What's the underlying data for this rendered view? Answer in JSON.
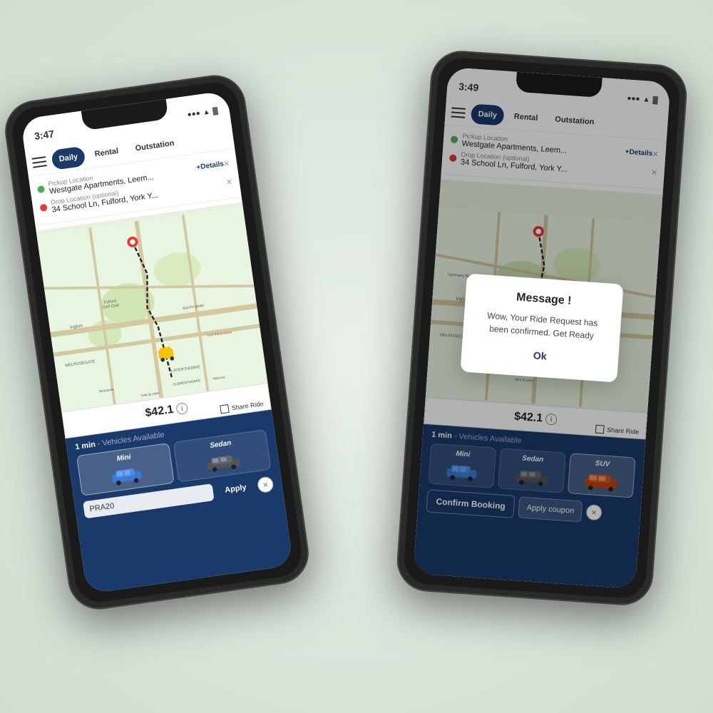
{
  "scene": {
    "background": "#e8ede8"
  },
  "phone1": {
    "status": {
      "time": "3:47",
      "icons": "●●● ▲ 🔋"
    },
    "tabs": {
      "active": "Daily",
      "items": [
        "Daily",
        "Rental",
        "Outstation"
      ]
    },
    "locations": {
      "pickup_label": "Pickup Location",
      "pickup_value": "Westgate Apartments, Leem...",
      "drop_label": "Drop Location (optional)",
      "drop_value": "34 School Ln, Fulford, York Y...",
      "details_link": "+Details"
    },
    "price": {
      "amount": "$42.1",
      "info": "ℹ"
    },
    "vehicles_header": {
      "time": "1 min",
      "label": "- Vehicles Available"
    },
    "vehicles": [
      {
        "name": "Mini",
        "active": true
      },
      {
        "name": "Sedan",
        "active": false
      }
    ],
    "coupon": {
      "placeholder": "PRA20",
      "apply_label": "Apply"
    },
    "share_ride": "Share Ride"
  },
  "phone2": {
    "status": {
      "time": "3:49",
      "icons": "●●● ▲ 🔋"
    },
    "tabs": {
      "active": "Daily",
      "items": [
        "Daily",
        "Rental",
        "Outstation"
      ]
    },
    "locations": {
      "pickup_label": "Pickup Location",
      "pickup_value": "Westgate Apartments, Leem...",
      "drop_label": "Drop Location (optional)",
      "drop_value": "34 School Ln, Fulford, York Y...",
      "details_link": "+Details"
    },
    "price": {
      "amount": "$42.1",
      "info": "ℹ"
    },
    "vehicles_header": {
      "time": "1 min",
      "label": "- Vehicles Available"
    },
    "vehicles": [
      {
        "name": "Mini",
        "active": false
      },
      {
        "name": "Sedan",
        "active": false
      },
      {
        "name": "SUV",
        "active": true
      }
    ],
    "bottom_buttons": {
      "confirm": "Confirm Booking",
      "coupon": "Apply coupon"
    },
    "share_ride": "Share Ride",
    "modal": {
      "title": "Message !",
      "body": "Wow, Your Ride Request has been confirmed. Get Ready",
      "ok_label": "Ok"
    }
  }
}
